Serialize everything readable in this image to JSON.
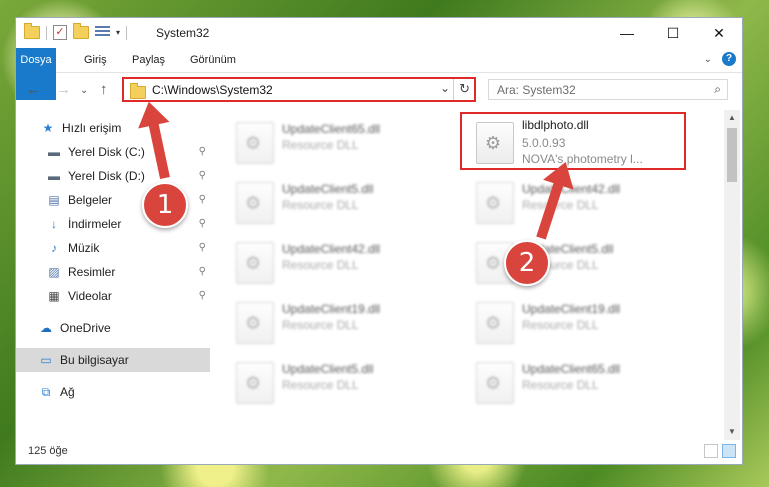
{
  "window": {
    "title": "System32"
  },
  "window_controls": {
    "minimize": "—",
    "maximize": "☐",
    "close": "✕"
  },
  "ribbon": {
    "tabs": [
      "Dosya",
      "Giriş",
      "Paylaş",
      "Görünüm"
    ],
    "expand": "⌄",
    "help": "?"
  },
  "address": {
    "path": "C:\\Windows\\System32",
    "dropdown": "⌄",
    "refresh": "↻"
  },
  "search": {
    "placeholder": "Ara: System32",
    "icon": "⌕"
  },
  "nav_buttons": {
    "back": "←",
    "forward": "→",
    "recent": "⌄",
    "up": "↑"
  },
  "sidebar": {
    "items": [
      {
        "label": "Hızlı erişim",
        "icon": "★",
        "pinned": false
      },
      {
        "label": "Yerel Disk (C:)",
        "icon": "▬",
        "pinned": true
      },
      {
        "label": "Yerel Disk (D:)",
        "icon": "▬",
        "pinned": true
      },
      {
        "label": "Belgeler",
        "icon": "▤",
        "pinned": true
      },
      {
        "label": "İndirmeler",
        "icon": "↓",
        "pinned": true
      },
      {
        "label": "Müzik",
        "icon": "♪",
        "pinned": true
      },
      {
        "label": "Resimler",
        "icon": "▨",
        "pinned": true
      },
      {
        "label": "Videolar",
        "icon": "▦",
        "pinned": true
      },
      {
        "label": "OneDrive",
        "icon": "☁",
        "pinned": false
      },
      {
        "label": "Bu bilgisayar",
        "icon": "▭",
        "pinned": false,
        "selected": true
      },
      {
        "label": "Ağ",
        "icon": "⧉",
        "pinned": false
      }
    ],
    "pin_glyph": "⚲"
  },
  "files": [
    {
      "name": "UpdateClient65.dll",
      "type": "Resource DLL"
    },
    {
      "name": "libdlphoto.dll",
      "version": "5.0.0.93",
      "description": "NOVA's photometry l...",
      "highlighted": true
    },
    {
      "name": "UpdateClient5.dll",
      "type": "Resource DLL"
    },
    {
      "name": "UpdateClient42.dll",
      "type": "Resource DLL"
    },
    {
      "name": "UpdateClient42.dll",
      "type": "Resource DLL"
    },
    {
      "name": "UpdateClient5.dll",
      "type": "Resource DLL"
    },
    {
      "name": "UpdateClient19.dll",
      "type": "Resource DLL"
    },
    {
      "name": "UpdateClient19.dll",
      "type": "Resource DLL"
    },
    {
      "name": "UpdateClient5.dll",
      "type": "Resource DLL"
    },
    {
      "name": "UpdateClient65.dll",
      "type": "Resource DLL"
    }
  ],
  "status": {
    "count": "125 öğe"
  },
  "annotations": {
    "step1": "1",
    "step2": "2",
    "color": "#d9443c"
  }
}
